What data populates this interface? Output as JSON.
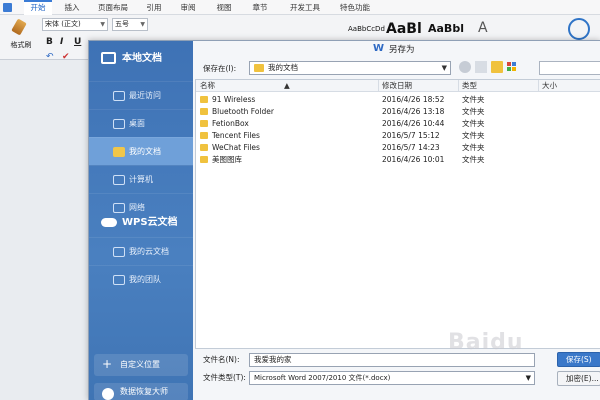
{
  "ribbon": {
    "tabs": [
      "开始",
      "插入",
      "页面布局",
      "引用",
      "审阅",
      "视图",
      "章节",
      "开发工具",
      "特色功能"
    ],
    "active_tab": "开始",
    "format_painter_label": "格式刷",
    "font_name": "宋体 (正文)",
    "font_size": "五号",
    "format_buttons": [
      "B",
      "I",
      "U"
    ],
    "styles": [
      "AaBbCcDd",
      "AaBl",
      "AaBbl"
    ]
  },
  "dialog": {
    "title": "另存为",
    "sidebar": {
      "local_docs": "本地文档",
      "local_items": [
        "最近访问",
        "桌面",
        "我的文档",
        "计算机",
        "网络"
      ],
      "active_item": "我的文档",
      "cloud_docs": "WPS云文档",
      "cloud_items": [
        "我的云文档",
        "我的团队"
      ],
      "custom_location": "自定义位置",
      "data_recovery": "数据恢复大师"
    },
    "save_in_label": "保存在(I):",
    "save_in_value": "我的文档",
    "columns": {
      "name": "名称",
      "modified": "修改日期",
      "type": "类型",
      "size": "大小"
    },
    "files": [
      {
        "name": "91 Wireless",
        "date": "2016/4/26 18:52",
        "type": "文件夹"
      },
      {
        "name": "Bluetooth Folder",
        "date": "2016/4/26 13:18",
        "type": "文件夹"
      },
      {
        "name": "FetionBox",
        "date": "2016/4/26 10:44",
        "type": "文件夹"
      },
      {
        "name": "Tencent Files",
        "date": "2016/5/7 15:12",
        "type": "文件夹"
      },
      {
        "name": "WeChat Files",
        "date": "2016/5/7 14:23",
        "type": "文件夹"
      },
      {
        "name": "美图图库",
        "date": "2016/4/26 10:01",
        "type": "文件夹"
      }
    ],
    "filename_label": "文件名(N):",
    "filename_value": "我爱我的家",
    "filetype_label": "文件类型(T):",
    "filetype_value": "Microsoft Word 2007/2010 文件(*.docx)",
    "save_button": "保存(S)",
    "encrypt_button": "加密(E)..."
  },
  "watermark": "Baidu",
  "colors": {
    "sidebar_blue": "#4a80c0",
    "sidebar_active": "#6fa0d9",
    "folder_yellow": "#f0c23e",
    "accent": "#3a78c9"
  }
}
